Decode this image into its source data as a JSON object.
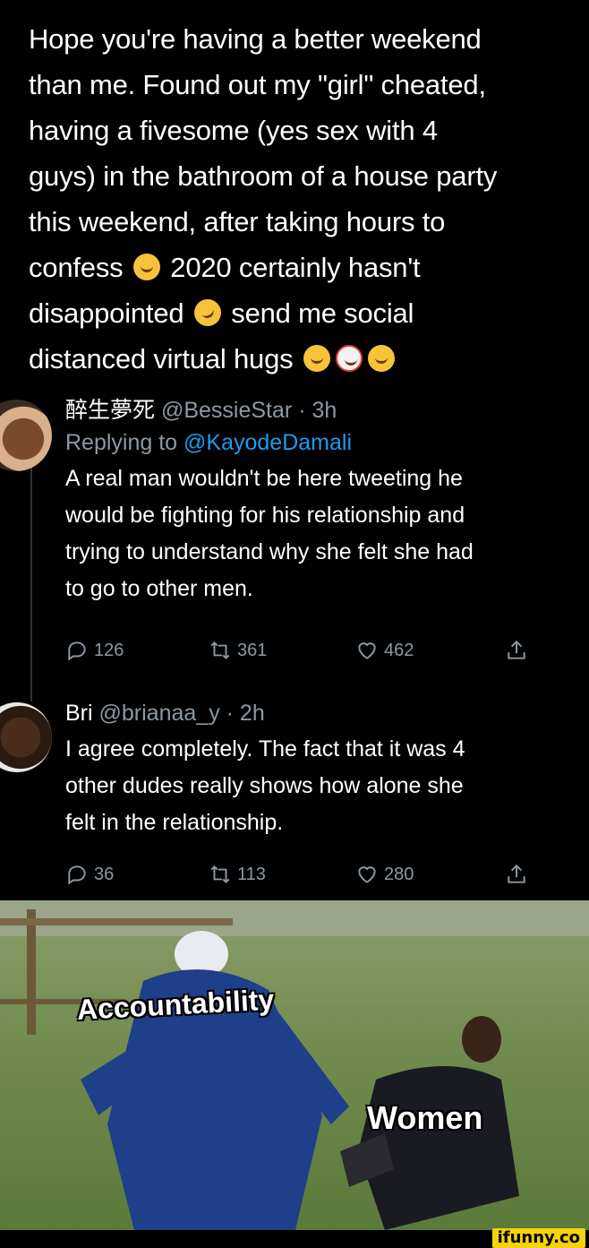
{
  "main_tweet": {
    "lines": [
      "Hope you're having a better weekend",
      "than me. Found out my \"girl\" cheated,",
      "having a fivesome (yes sex with 4",
      "guys) in the bathroom of a house party",
      "this weekend, after taking hours to"
    ],
    "line6_a": "confess",
    "line6_b": "2020 certainly hasn't",
    "line7_a": "disappointed",
    "line7_b": "send me social",
    "line8_a": "distanced virtual hugs",
    "emojis": [
      "hugging-face",
      "rolling-on-floor-laughing",
      "clown-face",
      "upside-down-face"
    ]
  },
  "replies": [
    {
      "name": "醉生夢死",
      "handle": "@BessieStar",
      "time": "· 3h",
      "replying_label": "Replying to",
      "replying_handle": "@KayodeDamali",
      "lines": [
        "A real man wouldn't be here tweeting he",
        "would be fighting for his relationship and",
        "trying to understand why she felt she had",
        "to go to other men."
      ],
      "reply_count": "126",
      "retweet_count": "361",
      "like_count": "462"
    },
    {
      "name": "Bri",
      "handle": "@brianaa_y",
      "time": "· 2h",
      "lines": [
        "I agree completely. The fact that it was 4",
        "other dudes really shows how alone she",
        "felt in the relationship."
      ],
      "reply_count": "36",
      "retweet_count": "113",
      "like_count": "280"
    }
  ],
  "meme": {
    "caption_top": "Accountability",
    "caption_bottom": "Women"
  },
  "watermark": "ifunny.co",
  "colors": {
    "background": "#000000",
    "text": "#ffffff",
    "muted": "#8b98a5",
    "link": "#1d9bf0",
    "watermark": "#f5d30a"
  }
}
